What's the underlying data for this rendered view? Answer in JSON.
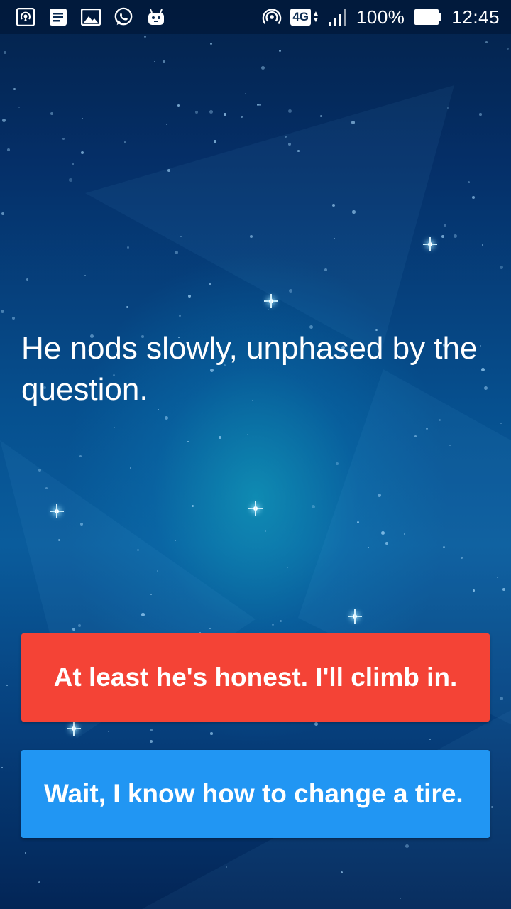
{
  "status_bar": {
    "icons_left": [
      "hotspot-icon",
      "notes-icon",
      "gallery-icon",
      "whatsapp-icon",
      "android-icon"
    ],
    "network_type": "4G",
    "battery_percent": "100%",
    "time": "12:45",
    "colors": {
      "foreground": "#ffffff"
    }
  },
  "story": {
    "text": "He nods slowly, unphased by the question."
  },
  "choices": [
    {
      "label": "At least he's honest. I'll climb in.",
      "color": "#f44336"
    },
    {
      "label": "Wait, I know how to change a tire.",
      "color": "#2196f3"
    }
  ],
  "background": {
    "theme": "blue-starfield",
    "colors": {
      "top": "#03224a",
      "center_glow": "#14b4c8",
      "bottom": "#032556"
    }
  }
}
